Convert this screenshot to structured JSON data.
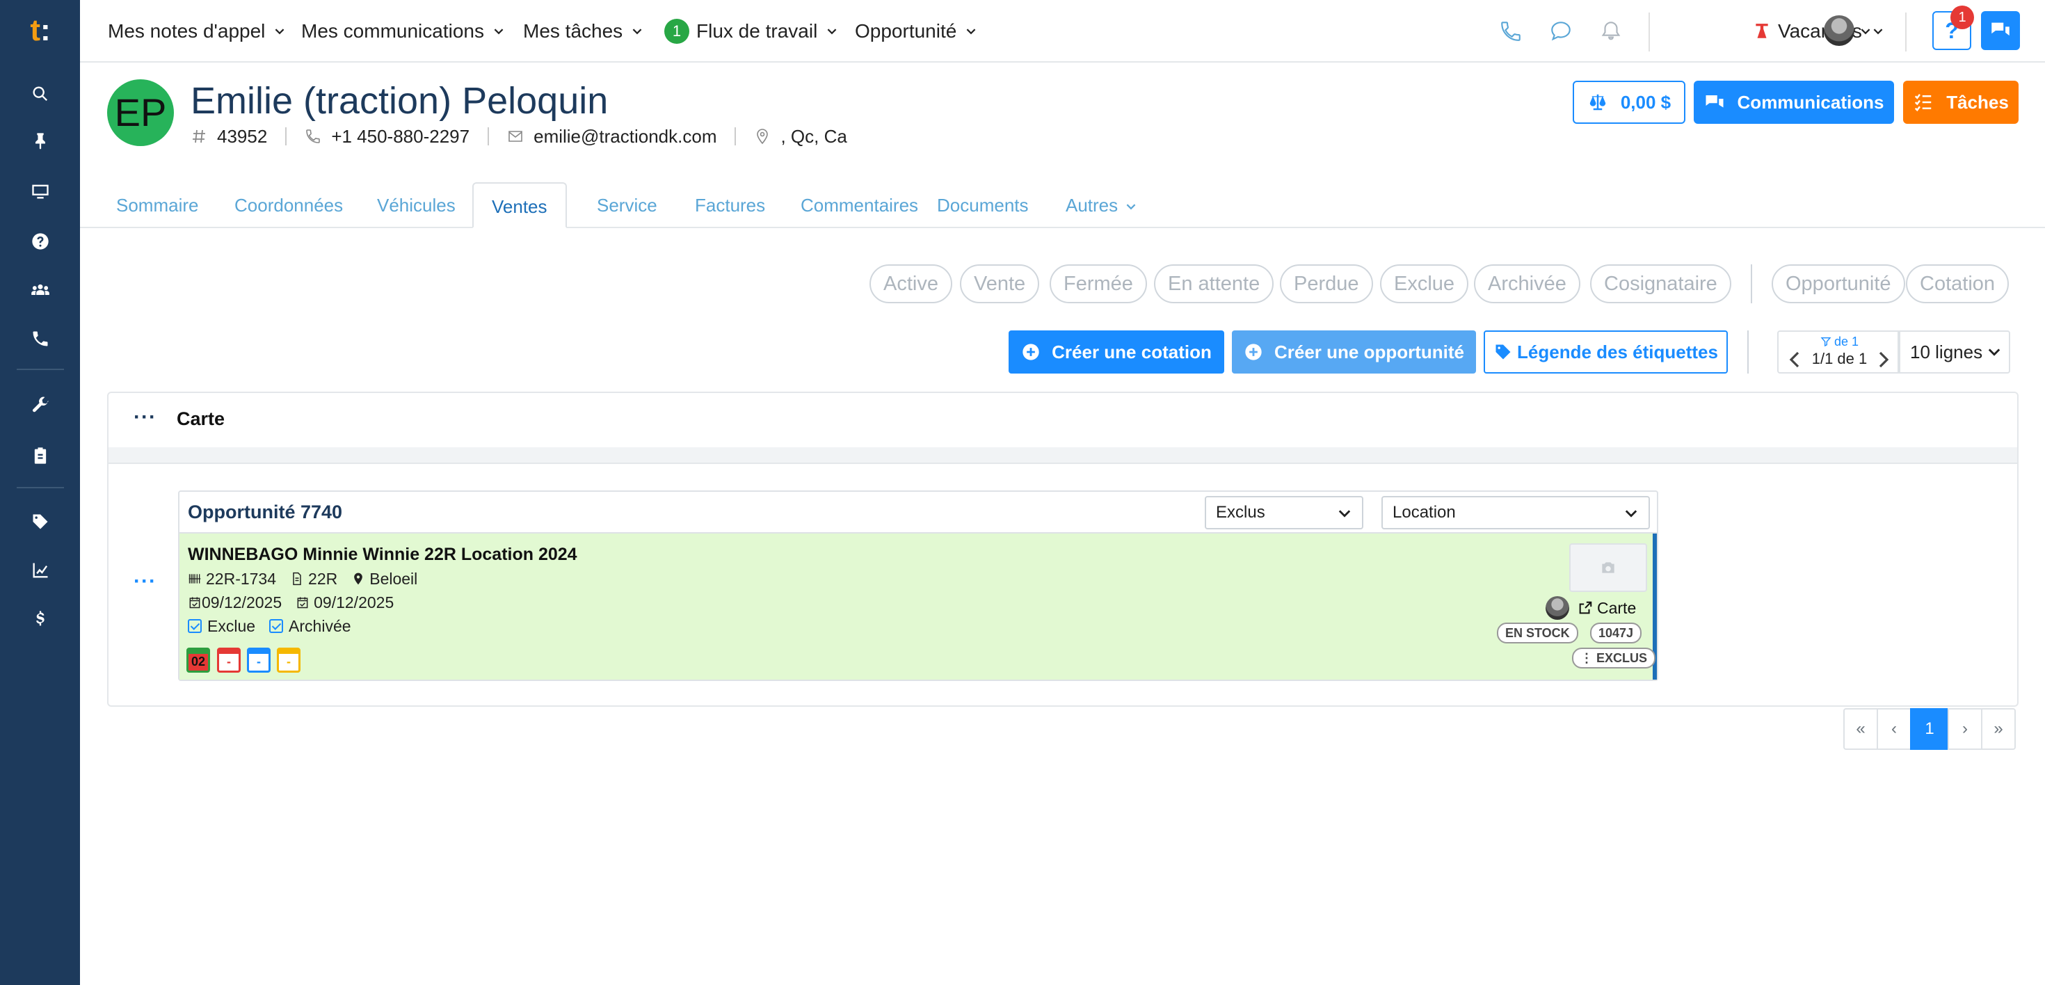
{
  "app": {
    "logo_letter": "t",
    "logo_dot": ":"
  },
  "topnav": {
    "menus": [
      {
        "label": "Mes notes d'appel"
      },
      {
        "label": "Mes communications"
      },
      {
        "label": "Mes tâches"
      },
      {
        "label": "Flux de travail",
        "count": "1"
      },
      {
        "label": "Opportunité"
      }
    ],
    "vacation_label": "Vacances",
    "help_label": "?",
    "help_badge": "1"
  },
  "sidebar": {
    "icons": [
      "search-icon",
      "pin-icon",
      "monitor-icon",
      "help-icon",
      "users-icon",
      "phone-icon",
      "wrench-icon",
      "clipboard-icon",
      "tag-icon",
      "chart-icon",
      "dollar-icon"
    ]
  },
  "contact": {
    "initials": "EP",
    "name": "Emilie (traction) Peloquin",
    "id": "43952",
    "phone": "+1 450-880-2297",
    "email": "emilie@tractiondk.com",
    "location": ", Qc, Ca"
  },
  "header_buttons": {
    "balance": "0,00 $",
    "communications": "Communications",
    "tasks": "Tâches"
  },
  "tabs": [
    {
      "label": "Sommaire"
    },
    {
      "label": "Coordonnées"
    },
    {
      "label": "Véhicules"
    },
    {
      "label": "Ventes",
      "active": true
    },
    {
      "label": "Service"
    },
    {
      "label": "Factures"
    },
    {
      "label": "Commentaires"
    },
    {
      "label": "Documents"
    },
    {
      "label": "Autres"
    }
  ],
  "status_filters": [
    "Active",
    "Vente",
    "Fermée",
    "En attente",
    "Perdue",
    "Exclue",
    "Archivée",
    "Cosignataire"
  ],
  "type_filters": [
    "Opportunité",
    "Cotation"
  ],
  "actions": {
    "create_quote": "Créer une cotation",
    "create_opportunity": "Créer une opportunité",
    "legend": "Légende des étiquettes"
  },
  "pager": {
    "filter_label": "de 1",
    "range": "1/1 de 1",
    "lines": "10 lignes"
  },
  "panel": {
    "menu_label": "···",
    "title": "Carte",
    "row_menu_label": "···"
  },
  "opportunity": {
    "title": "Opportunité 7740",
    "status_select": "Exclus",
    "type_select": "Location",
    "vehicle": "WINNEBAGO Minnie Winnie 22R Location 2024",
    "stock": "22R-1734",
    "model": "22R",
    "location": "Beloeil",
    "date1": "09/12/2025",
    "date2": "09/12/2025",
    "flags": [
      "Exclue",
      "Archivée"
    ],
    "calendars": [
      {
        "text": "02",
        "color": "#2e9e3f",
        "bg": "#e53935"
      },
      {
        "text": "-",
        "color": "#e53935",
        "bg": "#ffffff"
      },
      {
        "text": "-",
        "color": "#1a8cff",
        "bg": "#ffffff"
      },
      {
        "text": "-",
        "color": "#f5b800",
        "bg": "#ffffff"
      }
    ],
    "carte_link": "Carte",
    "tags": [
      "EN STOCK",
      "1047J"
    ],
    "tag_status": "⋮ EXCLUS"
  },
  "pagination": [
    "«",
    "‹",
    "1",
    "›",
    "»"
  ],
  "colors": {
    "sidebar": "#1d3a5c",
    "primary": "#1a8cff",
    "warning": "#ff7a00",
    "card_bg": "#e2f9d2"
  }
}
